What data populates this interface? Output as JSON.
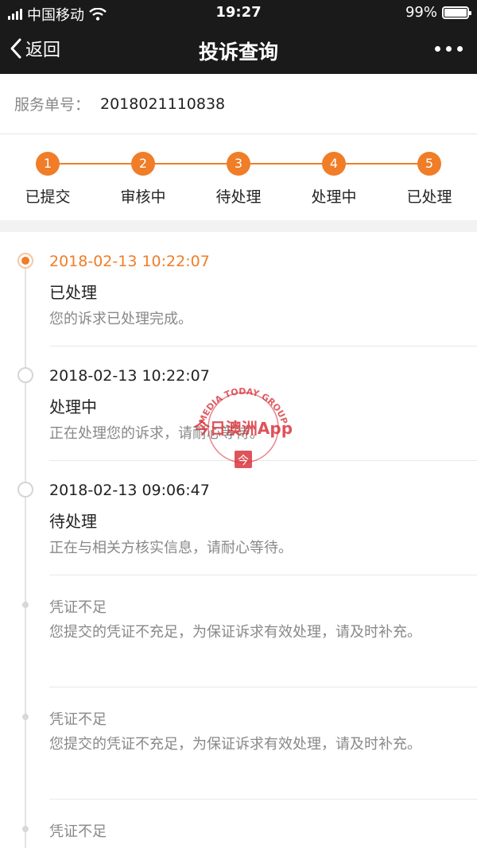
{
  "status_bar": {
    "carrier": "中国移动",
    "time": "19:27",
    "battery": "99%",
    "battery_level": 0.99
  },
  "nav": {
    "back_label": "返回",
    "title": "投诉查询"
  },
  "order": {
    "label": "服务单号：",
    "value": "2018021110838"
  },
  "steps": [
    {
      "number": "1",
      "label": "已提交"
    },
    {
      "number": "2",
      "label": "审核中"
    },
    {
      "number": "3",
      "label": "待处理"
    },
    {
      "number": "4",
      "label": "处理中"
    },
    {
      "number": "5",
      "label": "已处理"
    }
  ],
  "timeline": [
    {
      "time": "2018-02-13 10:22:07",
      "status": "已处理",
      "desc": "您的诉求已处理完成。"
    },
    {
      "time": "2018-02-13 10:22:07",
      "status": "处理中",
      "desc": "正在处理您的诉求，请耐心等待。"
    },
    {
      "time": "2018-02-13 09:06:47",
      "status": "待处理",
      "desc": "正在与相关方核实信息，请耐心等待。"
    }
  ],
  "notes": [
    {
      "title": "凭证不足",
      "desc": "您提交的凭证不充足，为保证诉求有效处理，请及时补充。"
    },
    {
      "title": "凭证不足",
      "desc": "您提交的凭证不充足，为保证诉求有效处理，请及时补充。"
    },
    {
      "title": "凭证不足"
    }
  ],
  "watermark": {
    "arc_text": "MEDIA TODAY GROUP",
    "brand": "今日澳洲App",
    "glyph": "今"
  },
  "colors": {
    "accent": "#f07d28",
    "watermark": "#d9363e"
  }
}
